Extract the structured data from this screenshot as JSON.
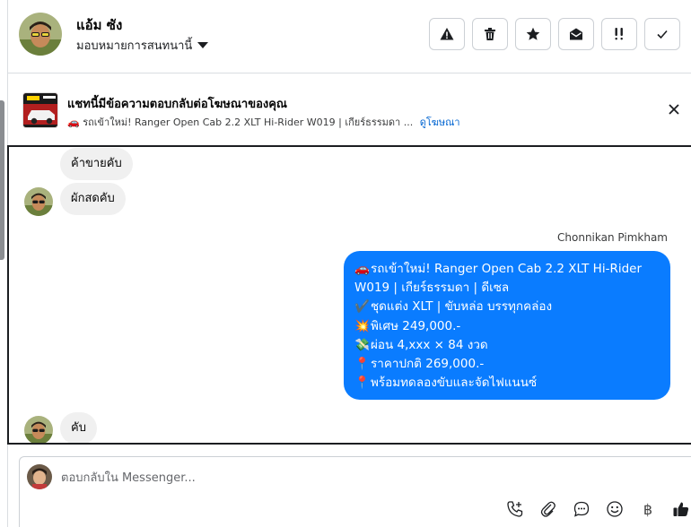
{
  "header": {
    "user_name": "แอ้ม ซัง",
    "assign_label": "มอบหมายการสนทนานี้",
    "toolbar": [
      "warning-icon",
      "trash-icon",
      "star-icon",
      "envelope-open-icon",
      "important-icon",
      "check-icon"
    ]
  },
  "ad_banner": {
    "title": "แชทนี้มีข้อความตอบกลับต่อโฆษณาของคุณ",
    "subtitle": "🚗 รถเข้าใหม่! Ranger Open Cab 2.2 XLT Hi-Rider W019 | เกียร์ธรรมดา ...",
    "link": "ดูโฆษณา"
  },
  "messages": {
    "incoming_1": "ค้าขายคับ",
    "incoming_2": "ผักสดคับ",
    "sender_name": "Chonnikan Pimkham",
    "outgoing_lines": [
      {
        "emoji": "🚗",
        "text": "รถเข้าใหม่! Ranger Open Cab 2.2 XLT Hi-Rider"
      },
      {
        "emoji": "",
        "text": "W019 | เกียร์ธรรมดา | ดีเซล"
      },
      {
        "emoji": "✔️",
        "text": "ชุดแต่ง XLT | ขับหล่อ บรรทุกคล่อง"
      },
      {
        "emoji": "💥",
        "text": "พิเศษ 249,000.-"
      },
      {
        "emoji": "💸",
        "text": "ผ่อน 4,xxx × 84 งวด"
      },
      {
        "emoji": "📍",
        "text": "ราคาปกติ 269,000.-"
      },
      {
        "emoji": "📍",
        "text": "พร้อมทดลองขับและจัดไฟแนนซ์"
      }
    ],
    "incoming_3": "คับ"
  },
  "composer": {
    "placeholder": "ตอบกลับใน Messenger...",
    "tools": [
      "phone-plus-icon",
      "paperclip-icon",
      "chat-bubble-icon",
      "smiley-icon",
      "baht-icon",
      "thumbs-up-icon"
    ],
    "baht_symbol": "฿"
  },
  "colors": {
    "outgoing_bubble": "#0a7cff",
    "incoming_bubble": "#f0f0f0",
    "link": "#0064d1"
  }
}
